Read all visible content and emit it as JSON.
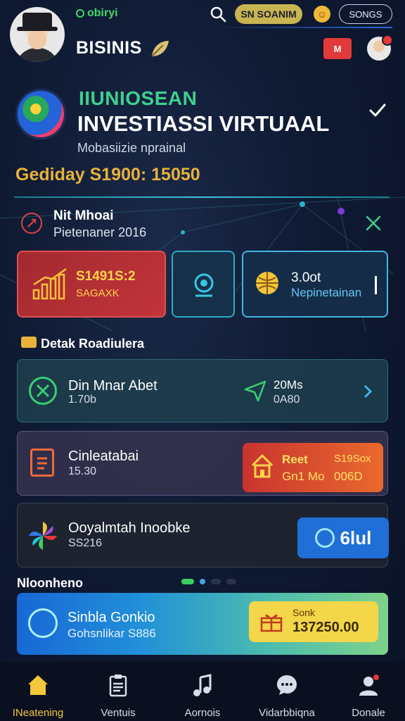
{
  "header": {
    "brand_small": "obiryi",
    "brand_name": "BISINIS",
    "pill_yellow": "SN SOANIM",
    "pill_outline": "SONGS",
    "badge": "M",
    "emoji": "☺"
  },
  "hero": {
    "subtitle": "IIUNIOSEAN",
    "title": "INVESTIASSI VIRTUAAL",
    "description": "Mobasiizie nprainal",
    "amount": "Gediday S1900: 15050"
  },
  "info": {
    "title": "Nit Mhoai",
    "subtitle": "Pietenaner 2016"
  },
  "cards": {
    "red": {
      "value": "S1491S:2",
      "label": "SAGAXK"
    },
    "blue": {
      "value": "3.0ot",
      "label": "Nepinetainan"
    }
  },
  "section_title": "Detak Roadiulera",
  "list": [
    {
      "title": "Din Mnar Abet",
      "subtitle": "1.70b",
      "right_value": "20Ms",
      "right_sub": "0A80"
    },
    {
      "title": "Cinleatabai",
      "subtitle": "15.30",
      "badge_a": "Reet",
      "badge_b": "Gn1 Mo",
      "badge_c": "S19Sox",
      "badge_d": "006D"
    },
    {
      "title": "Ooyalmtah Inoobke",
      "subtitle": "SS216",
      "button": "6lul"
    }
  ],
  "featured": {
    "title": "Nloonheno",
    "card_title": "Sinbla Gonkio",
    "card_subtitle": "Gohsnlikar S886",
    "badge_top": "Sonk",
    "badge_value": "137250.00"
  },
  "nav": [
    {
      "label": "INeatening",
      "icon": "home-icon",
      "active": true
    },
    {
      "label": "Ventuis",
      "icon": "clipboard-icon",
      "active": false
    },
    {
      "label": "Aornois",
      "icon": "music-icon",
      "active": false
    },
    {
      "label": "Vidarbbiqna",
      "icon": "chat-icon",
      "active": false
    },
    {
      "label": "Donale",
      "icon": "profile-icon",
      "active": false
    }
  ],
  "colors": {
    "accent_green": "#3fcf8e",
    "accent_gold": "#e8b23a",
    "accent_blue": "#1f6fd6",
    "background": "#0f1a33"
  }
}
